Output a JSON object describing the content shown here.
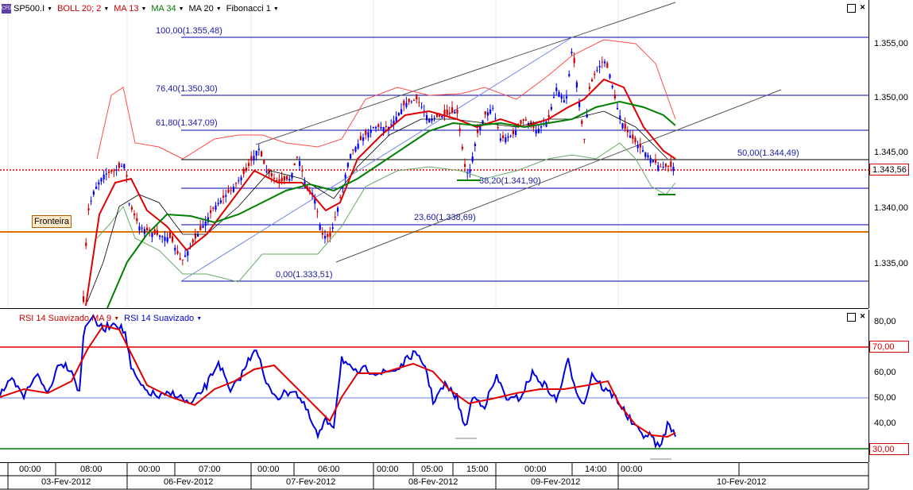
{
  "main_toolbar": {
    "symbol": "SP500.I",
    "indicators": [
      {
        "label": "BOLL 20; 2",
        "color": "#cc0000"
      },
      {
        "label": "MA 13",
        "color": "#cc0000"
      },
      {
        "label": "MA 34",
        "color": "#007700"
      },
      {
        "label": "MA 20",
        "color": "#000000"
      },
      {
        "label": "Fibonacci 1",
        "color": "#000000"
      }
    ]
  },
  "rsi_toolbar": {
    "indicators": [
      {
        "label": "RSI 14 Suavizado MA 9",
        "color": "#cc0000"
      },
      {
        "label": "RSI 14 Suavizado",
        "color": "#0000cc"
      }
    ]
  },
  "price_axis_ticks": [
    "1.355,00",
    "1.350,00",
    "1.345,00",
    "1.340,00",
    "1.335,00"
  ],
  "current_price": "1.343,56",
  "fibonacci_levels": [
    {
      "label": "100,00(1.355,48)"
    },
    {
      "label": "76,40(1.350,30)"
    },
    {
      "label": "61,80(1.347,09)"
    },
    {
      "label": "50,00(1.344,49)"
    },
    {
      "label": "38,20(1.341,90)"
    },
    {
      "label": "23,60(1.338,69)"
    },
    {
      "label": "0,00(1.333,51)"
    }
  ],
  "fronteira_label": "Fronteira",
  "rsi_axis_ticks": [
    "80,00",
    "60,00",
    "50,00",
    "40,00"
  ],
  "rsi_levels": {
    "overbought": "70,00",
    "oversold": "30,00"
  },
  "time_labels": [
    "00:00",
    "08:00",
    "00:00",
    "07:00",
    "00:00",
    "06:00",
    "00:00",
    "05:00",
    "15:00",
    "00:00",
    "14:00",
    "00:00"
  ],
  "date_labels": [
    "03-Fev-2012",
    "06-Fev-2012",
    "07-Fev-2012",
    "08-Fev-2012",
    "09-Fev-2012",
    "10-Fev-2012"
  ],
  "colors": {
    "bull_candle": "#0000ff",
    "bear_candle": "#cc0000",
    "fib_line": "#0000aa",
    "boll_band": "#ff4d4d",
    "ma13": "#e00000",
    "ma34": "#008000",
    "ma20": "#000000",
    "rsi": "#0000dd",
    "rsi_ma": "#e00000",
    "fronteira_line": "#e07000"
  }
}
